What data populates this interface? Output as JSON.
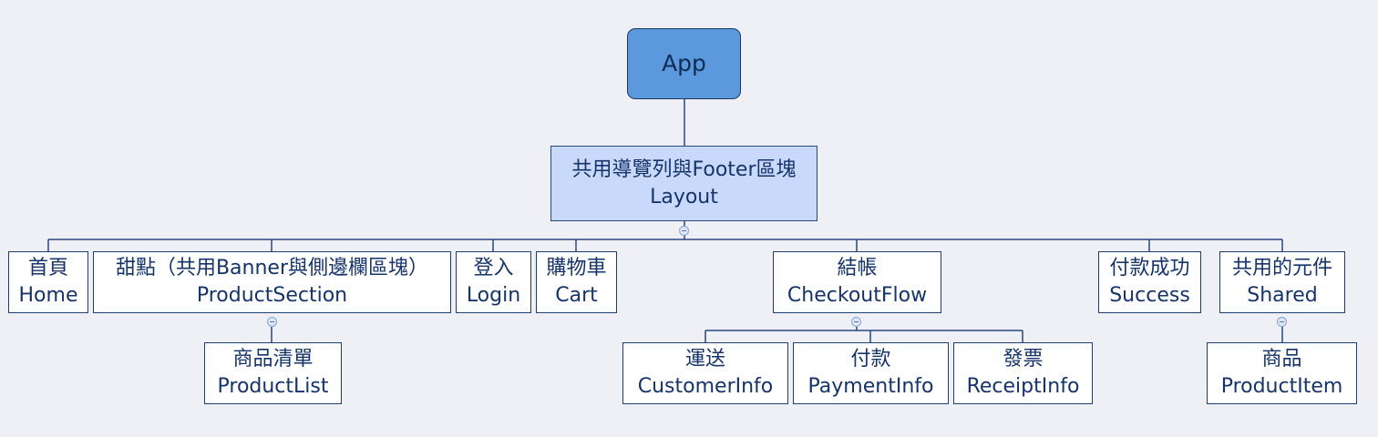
{
  "root": {
    "label": "App"
  },
  "layout": {
    "zh": "共用導覽列與Footer區塊",
    "en": "Layout"
  },
  "children": [
    {
      "key": "home",
      "zh": "首頁",
      "en": "Home"
    },
    {
      "key": "productsection",
      "zh": "甜點（共用Banner與側邊欄區塊）",
      "en": "ProductSection",
      "children": [
        {
          "key": "productlist",
          "zh": "商品清單",
          "en": "ProductList"
        }
      ]
    },
    {
      "key": "login",
      "zh": "登入",
      "en": "Login"
    },
    {
      "key": "cart",
      "zh": "購物車",
      "en": "Cart"
    },
    {
      "key": "checkoutflow",
      "zh": "結帳",
      "en": "CheckoutFlow",
      "children": [
        {
          "key": "customerinfo",
          "zh": "運送",
          "en": "CustomerInfo"
        },
        {
          "key": "paymentinfo",
          "zh": "付款",
          "en": "PaymentInfo"
        },
        {
          "key": "receiptinfo",
          "zh": "發票",
          "en": "ReceiptInfo"
        }
      ]
    },
    {
      "key": "success",
      "zh": "付款成功",
      "en": "Success"
    },
    {
      "key": "shared",
      "zh": "共用的元件",
      "en": "Shared",
      "children": [
        {
          "key": "productitem",
          "zh": "商品",
          "en": "ProductItem"
        }
      ]
    }
  ],
  "colors": {
    "background": "#eef0f6",
    "root_fill": "#5b98dc",
    "layout_fill": "#c9d9fb",
    "node_fill": "#ffffff",
    "border": "#1f3d6e",
    "text": "#16336a",
    "connector": "#2a4680"
  },
  "icons": {
    "collapse_toggle": "minus-circle-icon"
  }
}
